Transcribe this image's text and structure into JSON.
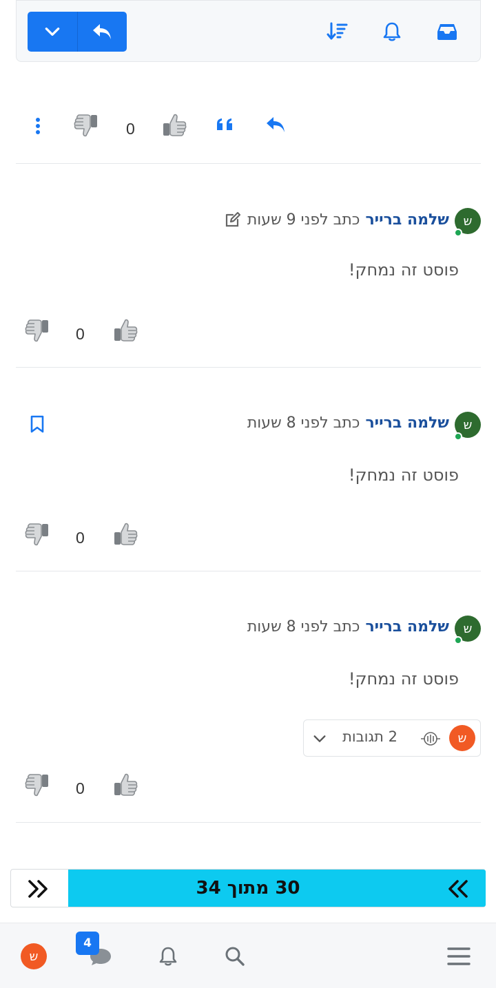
{
  "toolbar": {
    "reply_button": "reply-arrow-icon",
    "dropdown_button": "chevron-down-icon",
    "sort_icon": "sort-down-icon",
    "notifications_icon": "bell-icon",
    "inbox_icon": "inbox-icon"
  },
  "top_post_actions": {
    "vote_count": "0"
  },
  "posts": [
    {
      "avatar_letter": "ש",
      "author": "שלמה ברייר",
      "time": "כתב לפני 9 שעות",
      "edited": true,
      "text": "פוסט זה נמחק!",
      "vote_count": "0"
    },
    {
      "avatar_letter": "ש",
      "author": "שלמה ברייר",
      "time": "כתב לפני 8 שעות",
      "bookmark": true,
      "text": "פוסט זה נמחק!",
      "vote_count": "0"
    },
    {
      "avatar_letter": "ש",
      "author": "שלמה ברייר",
      "time": "כתב לפני 8 שעות",
      "text": "פוסט זה נמחק!",
      "replies_label": "2 תגובות",
      "replies_avatar_letter": "ש",
      "vote_count": "0"
    }
  ],
  "pagination": {
    "label": "30 מתוך 34",
    "progress_fraction": 0.88
  },
  "bottom_nav": {
    "profile_letter": "ש",
    "chat_badge": "4"
  },
  "colors": {
    "accent": "#1877f2",
    "author": "#1a4f9c",
    "pager_fill": "#0dcaf0",
    "avatar_green": "#2e6b2f",
    "avatar_orange": "#f15a24"
  }
}
